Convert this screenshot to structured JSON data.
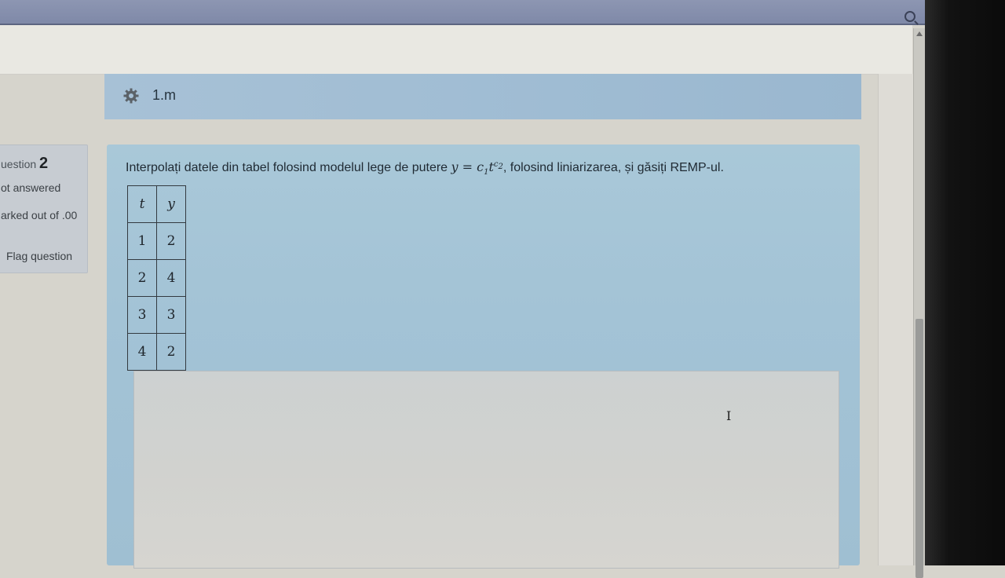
{
  "activity": {
    "title": "1.m",
    "icon": "gear-icon"
  },
  "question_info": {
    "number_label": "uestion",
    "number": "2",
    "state": "ot answered",
    "marked": "arked out of .00",
    "flag_label": "Flag question"
  },
  "question": {
    "text_before": "Interpolați datele din tabel folosind modelul lege de putere ",
    "formula_y": "y",
    "formula_eq": " = ",
    "formula_c": "c",
    "formula_c_sub": "1",
    "formula_t": "t",
    "formula_exp": "c",
    "formula_exp_sub": "2",
    "text_after": ", folosind liniarizarea, și găsiți REMP-ul."
  },
  "table": {
    "headers": [
      "t",
      "y"
    ],
    "rows": [
      [
        "1",
        "2"
      ],
      [
        "2",
        "4"
      ],
      [
        "3",
        "3"
      ],
      [
        "4",
        "2"
      ]
    ]
  },
  "colors": {
    "activity_bar": "#a7c1d6",
    "question_panel": "#a9c8d8",
    "info_box": "#c7ccd2"
  }
}
